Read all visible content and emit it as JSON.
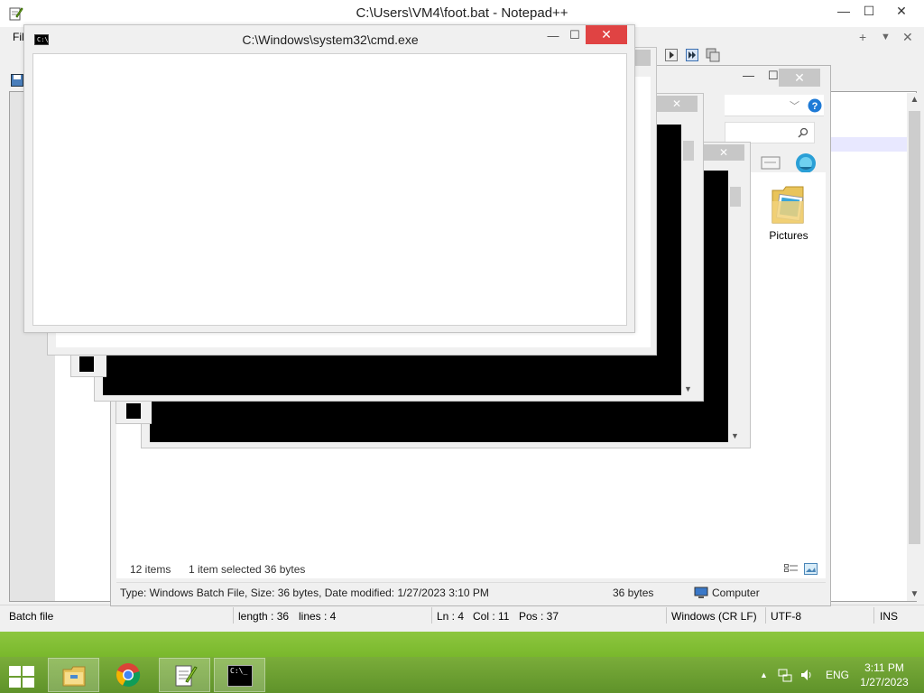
{
  "notepad": {
    "title": "C:\\Users\\VM4\\foot.bat - Notepad++",
    "menu_file": "Fil",
    "plus": "+",
    "dropdown": "▼",
    "close_x": "✕",
    "min": "—",
    "max": "☐",
    "status": {
      "type": "Batch file",
      "length": "length : 36",
      "lines": "lines : 4",
      "ln": "Ln : 4",
      "col": "Col : 11",
      "pos": "Pos : 37",
      "eol": "Windows (CR LF)",
      "encoding": "UTF-8",
      "mode": "INS"
    }
  },
  "explorer": {
    "folder_label": "Pictures",
    "items_count": "12 items",
    "selected": "1 item selected  36 bytes",
    "details": "Type: Windows Batch File, Size: 36 bytes, Date modified: 1/27/2023 3:10 PM",
    "size": "36 bytes",
    "location": "Computer",
    "close_x": "✕"
  },
  "ghost_close": "✕",
  "cmd": {
    "title": "C:\\Windows\\system32\\cmd.exe",
    "icon_text": "C:\\",
    "min": "—",
    "max": "☐",
    "close": "✕"
  },
  "taskbar": {
    "lang": "ENG",
    "time": "3:11 PM",
    "date": "1/27/2023",
    "cmd_icon_text": "C:\\_"
  }
}
